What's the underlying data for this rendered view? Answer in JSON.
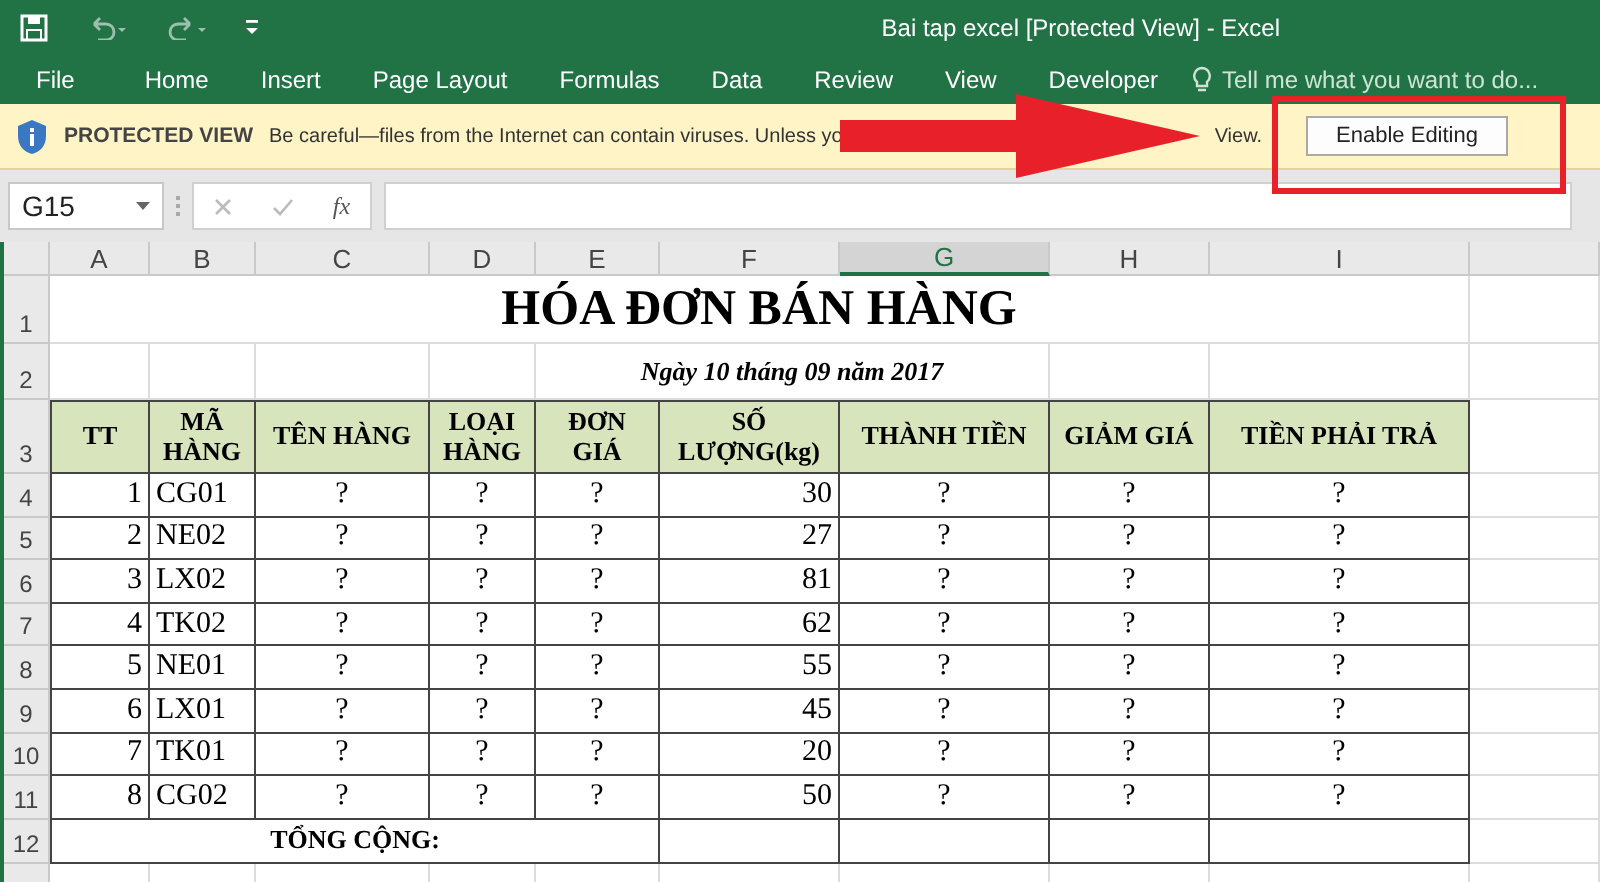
{
  "window": {
    "title": "Bai tap excel  [Protected View] - Excel"
  },
  "ribbon": {
    "tabs": [
      "File",
      "Home",
      "Insert",
      "Page Layout",
      "Formulas",
      "Data",
      "Review",
      "View",
      "Developer"
    ],
    "tell_me": {
      "placeholder": "Tell me what you want to do..."
    }
  },
  "protected_view": {
    "label": "PROTECTED VIEW",
    "message": "Be careful—files from the Internet can contain viruses. Unless yo",
    "message_end": "View.",
    "button": "Enable Editing"
  },
  "formula_bar": {
    "name_box": "G15",
    "fx": "fx"
  },
  "columns": [
    {
      "label": "A",
      "selected": false
    },
    {
      "label": "B",
      "selected": false
    },
    {
      "label": "C",
      "selected": false
    },
    {
      "label": "D",
      "selected": false
    },
    {
      "label": "E",
      "selected": false
    },
    {
      "label": "F",
      "selected": false
    },
    {
      "label": "G",
      "selected": true
    },
    {
      "label": "H",
      "selected": false
    },
    {
      "label": "I",
      "selected": false
    }
  ],
  "row_numbers": [
    "1",
    "2",
    "3",
    "4",
    "5",
    "6",
    "7",
    "8",
    "9",
    "10",
    "11",
    "12"
  ],
  "sheet": {
    "title": "HÓA ĐƠN BÁN HÀNG",
    "date": "Ngày 10 tháng 09 năm 2017",
    "headers": [
      "TT",
      "MÃ\nHÀNG",
      "TÊN HÀNG",
      "LOẠI\nHÀNG",
      "ĐƠN\nGIÁ",
      "SỐ\nLƯỢNG(kg)",
      "THÀNH TIỀN",
      "GIẢM GIÁ",
      "TIỀN PHẢI TRẢ"
    ],
    "items": [
      [
        "1",
        "CG01",
        "?",
        "?",
        "?",
        "30",
        "?",
        "?",
        "?"
      ],
      [
        "2",
        "NE02",
        "?",
        "?",
        "?",
        "27",
        "?",
        "?",
        "?"
      ],
      [
        "3",
        "LX02",
        "?",
        "?",
        "?",
        "81",
        "?",
        "?",
        "?"
      ],
      [
        "4",
        "TK02",
        "?",
        "?",
        "?",
        "62",
        "?",
        "?",
        "?"
      ],
      [
        "5",
        "NE01",
        "?",
        "?",
        "?",
        "55",
        "?",
        "?",
        "?"
      ],
      [
        "6",
        "LX01",
        "?",
        "?",
        "?",
        "45",
        "?",
        "?",
        "?"
      ],
      [
        "7",
        "TK01",
        "?",
        "?",
        "?",
        "20",
        "?",
        "?",
        "?"
      ],
      [
        "8",
        "CG02",
        "?",
        "?",
        "?",
        "50",
        "?",
        "?",
        "?"
      ]
    ],
    "total_label": "TỔNG CỘNG:"
  }
}
